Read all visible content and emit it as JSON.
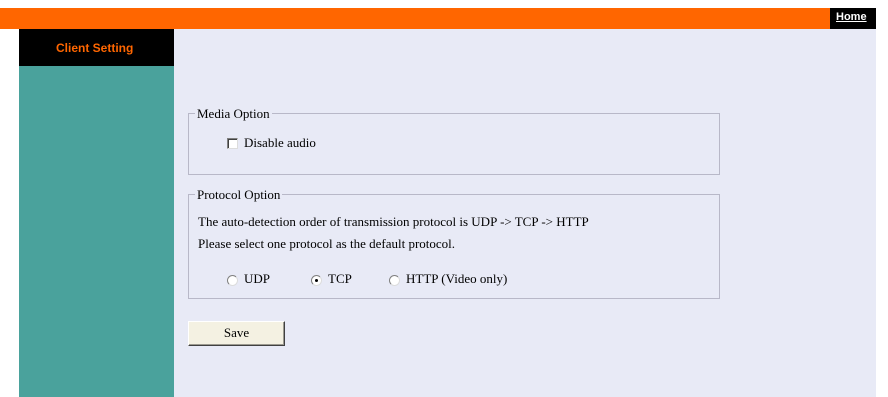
{
  "header": {
    "home_label": "Home"
  },
  "sidebar": {
    "title": "Client Setting"
  },
  "media_option": {
    "legend": "Media Option",
    "disable_audio_label": "Disable audio",
    "disable_audio_checked": false
  },
  "protocol_option": {
    "legend": "Protocol Option",
    "line1": "The auto-detection order of transmission protocol is UDP -> TCP -> HTTP",
    "line2": "Please select one protocol as the default protocol.",
    "options": [
      {
        "label": "UDP",
        "checked": false
      },
      {
        "label": "TCP",
        "checked": true
      },
      {
        "label": "HTTP (Video only)",
        "checked": false
      }
    ]
  },
  "actions": {
    "save_label": "Save"
  },
  "colors": {
    "topbar": "#ff6600",
    "sidebar": "#4aa29c",
    "sidebar_header": "#000000",
    "sidebar_title": "#ff6600",
    "content_bg": "#e8eaf6"
  }
}
